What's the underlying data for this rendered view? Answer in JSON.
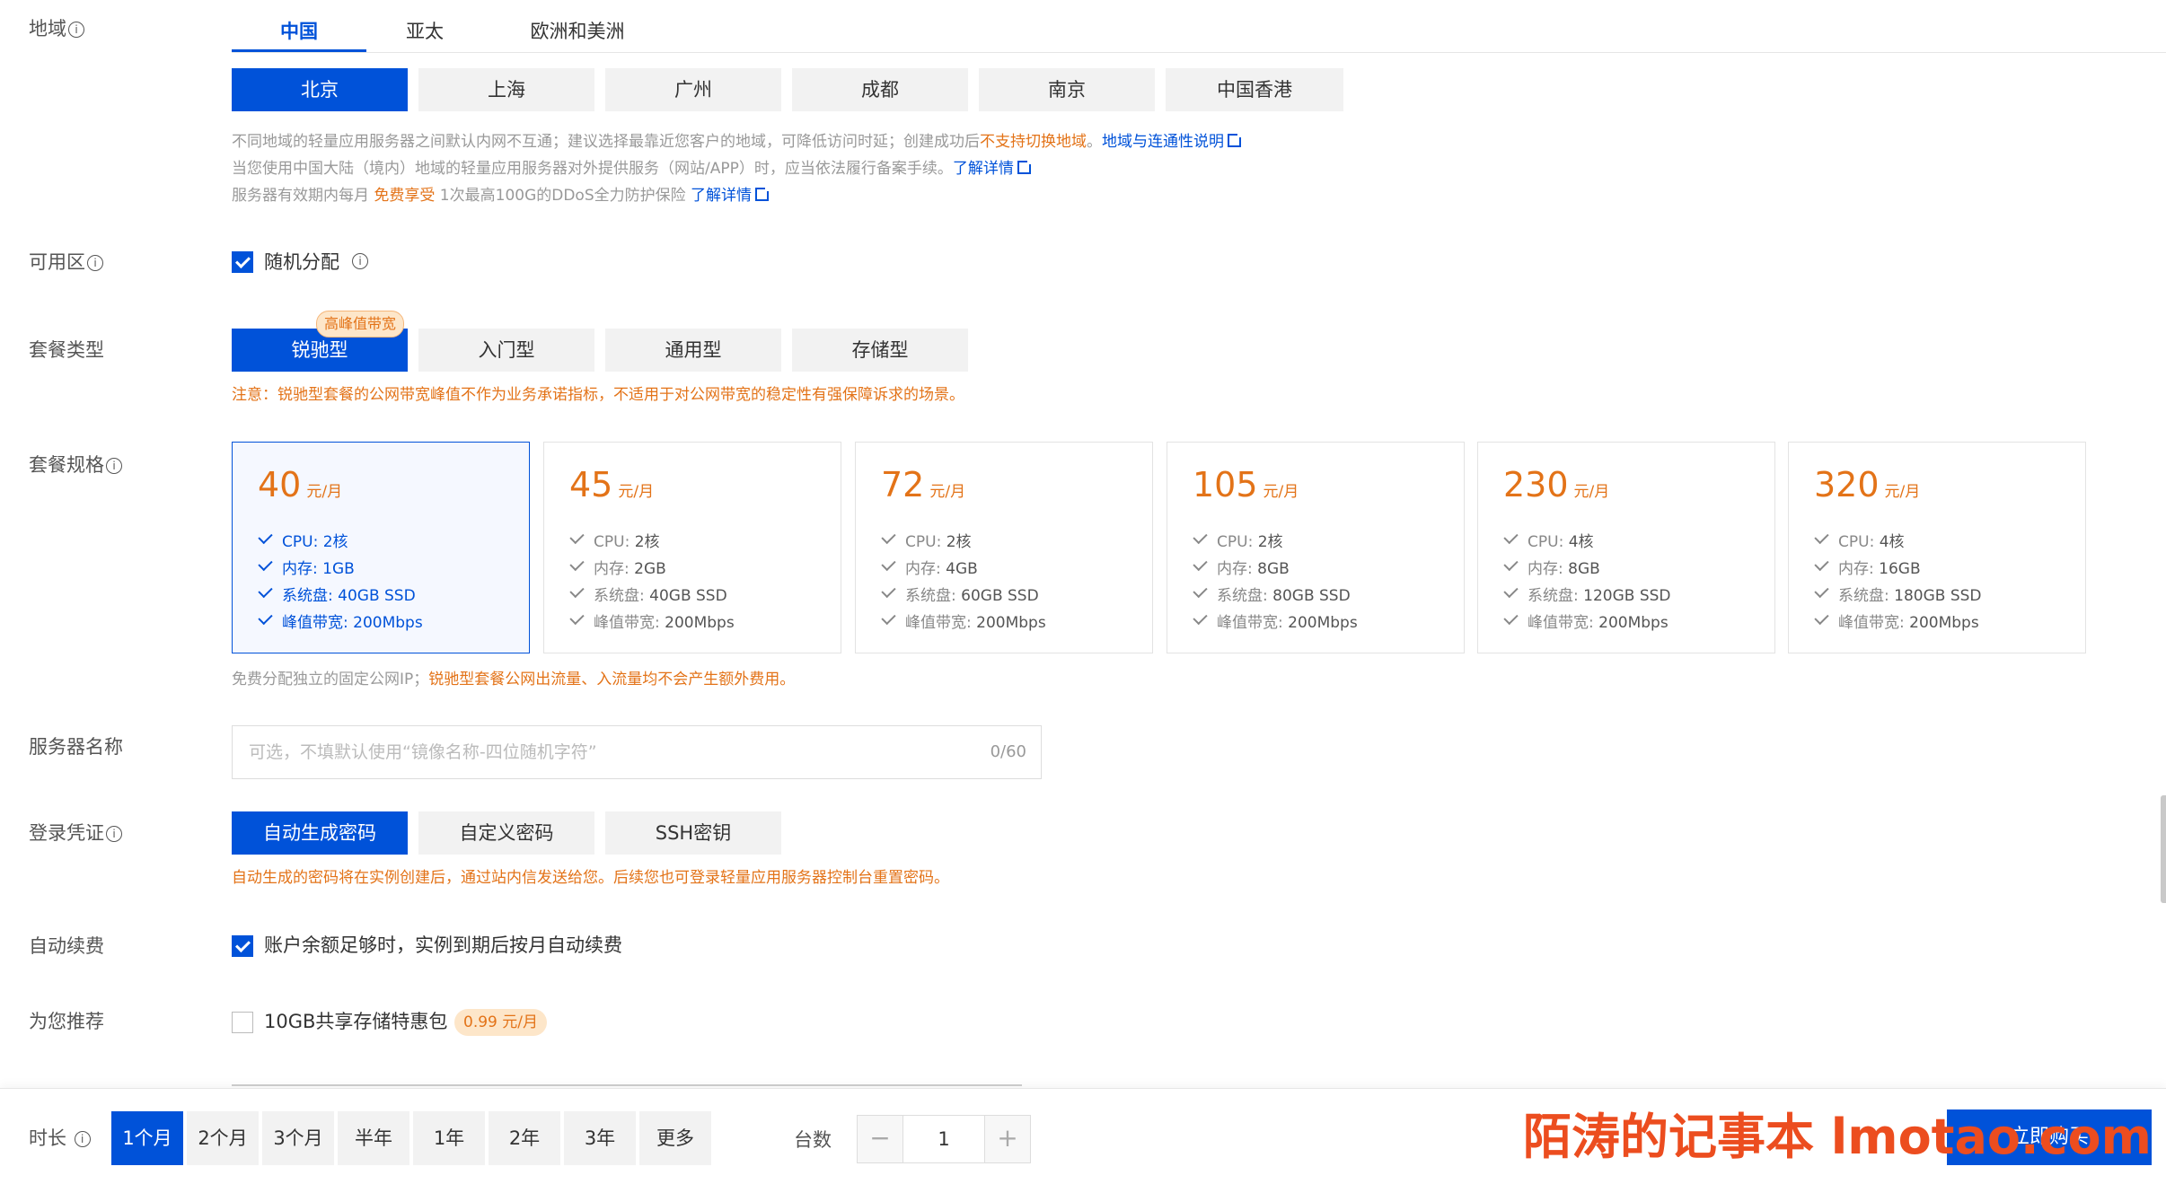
{
  "labels": {
    "region": "地域",
    "zone": "可用区",
    "plan_type": "套餐类型",
    "plan_spec": "套餐规格",
    "server_name": "服务器名称",
    "login": "登录凭证",
    "auto_renew": "自动续费",
    "recommend": "为您推荐",
    "duration": "时长",
    "quantity": "台数",
    "info_glyph": "i"
  },
  "region": {
    "tabs": [
      "中国",
      "亚太",
      "欧洲和美洲"
    ],
    "active_tab": "中国",
    "cities": [
      "北京",
      "上海",
      "广州",
      "成都",
      "南京",
      "中国香港"
    ],
    "active_city": "北京",
    "note1": {
      "prefix": "不同地域的轻量应用服务器之间默认内网不互通；建议选择最靠近您客户的地域，可降低访问时延；创建成功后",
      "highlight": "不支持切换地域",
      "sep": "。",
      "link": "地域与连通性说明"
    },
    "note2": {
      "text": "当您使用中国大陆（境内）地域的轻量应用服务器对外提供服务（网站/APP）时，应当依法履行备案手续。",
      "link": "了解详情"
    },
    "note3": {
      "prefix": "服务器有效期内每月 ",
      "highlight": "免费享受",
      "text": " 1次最高100G的DDoS全力防护保险 ",
      "link": "了解详情"
    }
  },
  "zone": {
    "checkbox_label": "随机分配",
    "checked": true
  },
  "plan_types": {
    "items": [
      "锐驰型",
      "入门型",
      "通用型",
      "存储型"
    ],
    "active": "锐驰型",
    "badge": "高峰值带宽",
    "warning": "注意：锐驰型套餐的公网带宽峰值不作为业务承诺指标，不适用于对公网带宽的稳定性有强保障诉求的场景。"
  },
  "plans": [
    {
      "price": "40",
      "unit": "元/月",
      "cpu": "2核",
      "mem": "1GB",
      "disk": "40GB SSD",
      "bw": "200Mbps",
      "active": true
    },
    {
      "price": "45",
      "unit": "元/月",
      "cpu": "2核",
      "mem": "2GB",
      "disk": "40GB SSD",
      "bw": "200Mbps"
    },
    {
      "price": "72",
      "unit": "元/月",
      "cpu": "2核",
      "mem": "4GB",
      "disk": "60GB SSD",
      "bw": "200Mbps"
    },
    {
      "price": "105",
      "unit": "元/月",
      "cpu": "2核",
      "mem": "8GB",
      "disk": "80GB SSD",
      "bw": "200Mbps"
    },
    {
      "price": "230",
      "unit": "元/月",
      "cpu": "4核",
      "mem": "8GB",
      "disk": "120GB SSD",
      "bw": "200Mbps"
    },
    {
      "price": "320",
      "unit": "元/月",
      "cpu": "4核",
      "mem": "16GB",
      "disk": "180GB SSD",
      "bw": "200Mbps"
    }
  ],
  "plan_keys": {
    "cpu": "CPU: ",
    "mem": "内存: ",
    "disk": "系统盘: ",
    "bw": "峰值带宽: "
  },
  "plan_note": {
    "prefix": "免费分配独立的固定公网IP；",
    "highlight": "锐驰型套餐公网出流量、入流量均不会产生额外费用。"
  },
  "server_name": {
    "placeholder": "可选，不填默认使用“镜像名称-四位随机字符”",
    "value": "",
    "counter": "0/60"
  },
  "login": {
    "options": [
      "自动生成密码",
      "自定义密码",
      "SSH密钥"
    ],
    "active": "自动生成密码",
    "note": "自动生成的密码将在实例创建后，通过站内信发送给您。后续您也可登录轻量应用服务器控制台重置密码。"
  },
  "auto_renew": {
    "label": "账户余额足够时，实例到期后按月自动续费",
    "checked": true
  },
  "recommend": {
    "label": "10GB共享存储特惠包",
    "price": "0.99 元/月",
    "checked": false
  },
  "duration": {
    "options": [
      "1个月",
      "2个月",
      "3个月",
      "半年",
      "1年",
      "2年",
      "3年",
      "更多"
    ],
    "active": "1个月"
  },
  "quantity": {
    "value": "1",
    "minus": "−",
    "plus": "+"
  },
  "buy_button": "立即购买",
  "watermark": "陌涛的记事本 lmotao.com",
  "colors": {
    "primary": "#0052d9",
    "accent": "#e37318"
  }
}
